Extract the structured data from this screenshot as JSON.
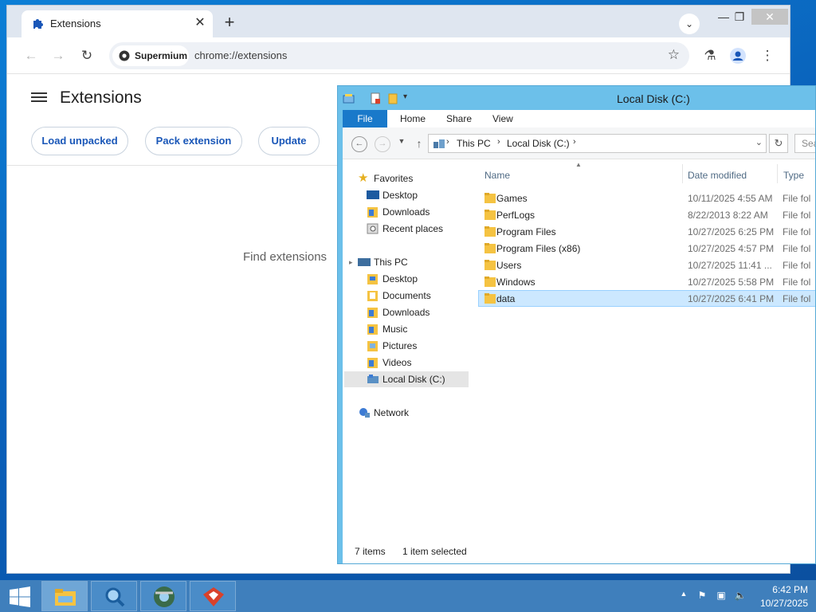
{
  "chrome": {
    "tab_title": "Extensions",
    "tab_close": "✕",
    "new_tab": "+",
    "omnibox_chip": "Supermium",
    "url": "chrome://extensions"
  },
  "extensions_page": {
    "title": "Extensions",
    "buttons": [
      "Load unpacked",
      "Pack extension",
      "Update"
    ],
    "find_text": "Find extensions"
  },
  "explorer": {
    "title": "Local Disk (C:)",
    "ribbon_tabs": [
      "File",
      "Home",
      "Share",
      "View"
    ],
    "breadcrumb": [
      "This PC",
      "Local Disk (C:)"
    ],
    "search_placeholder": "Sea",
    "nav": {
      "favorites": "Favorites",
      "favorites_items": [
        "Desktop",
        "Downloads",
        "Recent places"
      ],
      "this_pc": "This PC",
      "this_pc_items": [
        "Desktop",
        "Documents",
        "Downloads",
        "Music",
        "Pictures",
        "Videos",
        "Local Disk (C:)"
      ],
      "network": "Network"
    },
    "columns": [
      "Name",
      "Date modified",
      "Type"
    ],
    "files": [
      {
        "name": "Games",
        "date": "10/11/2025 4:55 AM",
        "type": "File fol"
      },
      {
        "name": "PerfLogs",
        "date": "8/22/2013 8:22 AM",
        "type": "File fol"
      },
      {
        "name": "Program Files",
        "date": "10/27/2025 6:25 PM",
        "type": "File fol"
      },
      {
        "name": "Program Files (x86)",
        "date": "10/27/2025 4:57 PM",
        "type": "File fol"
      },
      {
        "name": "Users",
        "date": "10/27/2025 11:41 ...",
        "type": "File fol"
      },
      {
        "name": "Windows",
        "date": "10/27/2025 5:58 PM",
        "type": "File fol"
      },
      {
        "name": "data",
        "date": "10/27/2025 6:41 PM",
        "type": "File fol"
      }
    ],
    "status_items": "7 items",
    "status_selected": "1 item selected"
  },
  "taskbar": {
    "time": "6:42 PM",
    "date": "10/27/2025"
  },
  "colors": {
    "accent_blue": "#1979ca",
    "selection": "#cce8ff",
    "taskbar": "#3f7fbc",
    "extension_button_text": "#1a57b8"
  }
}
